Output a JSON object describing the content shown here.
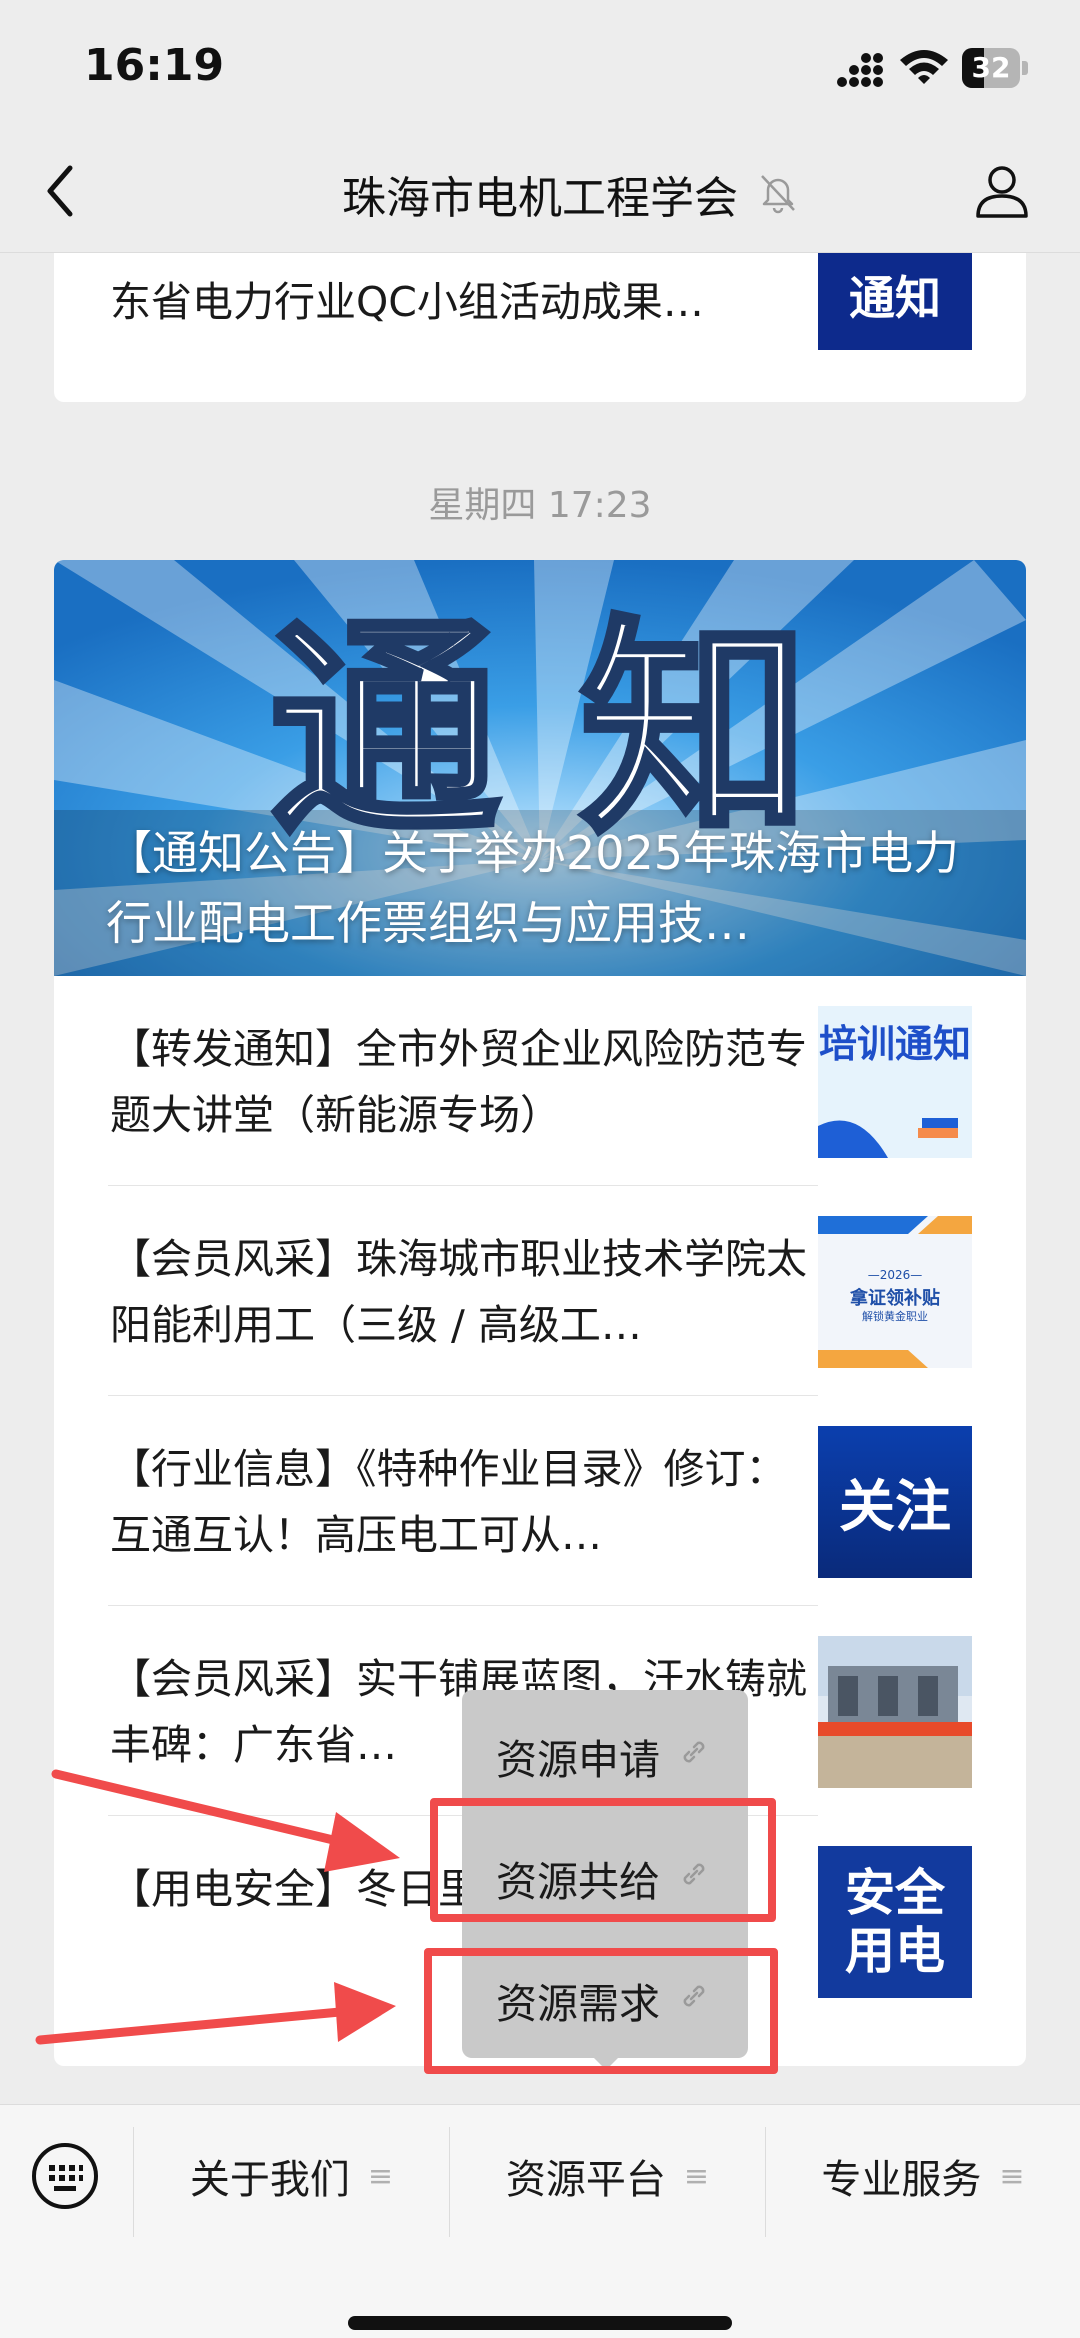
{
  "status": {
    "time": "16:19",
    "battery": "32"
  },
  "nav": {
    "title": "珠海市电机工程学会"
  },
  "top_card": {
    "title": "东省电力行业QC小组活动成果…",
    "thumb_text": "通知"
  },
  "timestamp": "星期四 17:23",
  "cover": {
    "big_text": "通 知",
    "title": "【通知公告】关于举办2025年珠海市电力行业配电工作票组织与应用技…"
  },
  "items": [
    {
      "title": "【转发通知】全市外贸企业风险防范专题大讲堂（新能源专场）",
      "thumb": "培训通知"
    },
    {
      "title": "【会员风采】珠海城市职业技术学院太阳能利用工（三级 / 高级工…",
      "thumb_year": "—2026—",
      "thumb_main": "拿证领补贴",
      "thumb_sub": "解锁黄金职业"
    },
    {
      "title": "【行业信息】《特种作业目录》修订：互通互认！高压电工可从…",
      "thumb": "关注"
    },
    {
      "title": "【会员风采】实干铺展蓝图，汗水铸就丰碑：广东省…"
    },
    {
      "title": "【用电安全】冬日里…暗藏风险?！",
      "thumb": "安全用电"
    }
  ],
  "popup": {
    "items": [
      {
        "label": "资源申请"
      },
      {
        "label": "资源共给"
      },
      {
        "label": "资源需求"
      }
    ]
  },
  "bottom_menu": [
    {
      "label": "关于我们"
    },
    {
      "label": "资源平台"
    },
    {
      "label": "专业服务"
    }
  ],
  "colors": {
    "accent_red": "#f04b4b",
    "thumb_navy": "#0d2a8c"
  }
}
